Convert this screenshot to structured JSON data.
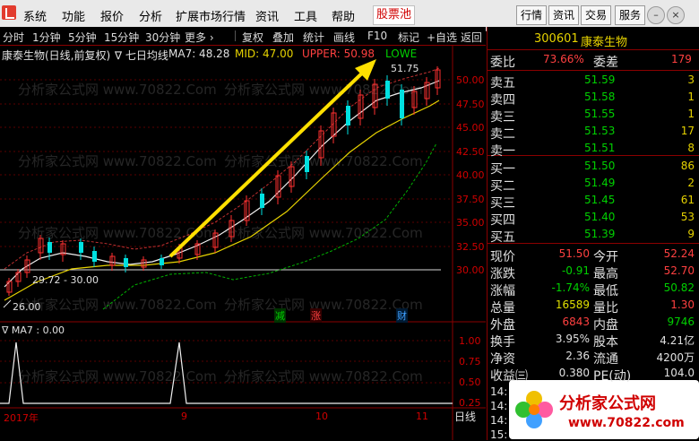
{
  "menu": {
    "items": [
      "系统",
      "功能",
      "报价",
      "分析",
      "扩展市场行情",
      "资讯",
      "工具",
      "帮助"
    ],
    "highlight": "股票池",
    "right_tabs": [
      "行情",
      "资讯",
      "交易",
      "服务"
    ]
  },
  "toolbar": {
    "items": [
      "分时",
      "1分钟",
      "5分钟",
      "15分钟",
      "30分钟",
      "更多 ›"
    ],
    "actions": [
      "复权",
      "叠加",
      "统计",
      "画线",
      "F10",
      "标记",
      "+自选",
      "返回"
    ]
  },
  "chart": {
    "stock_name": "康泰生物(日线,前复权)",
    "ma_label": "∇ 七日均线",
    "ma7": "MA7: 48.28",
    "mid": "MID: 47.00",
    "upper": "UPPER: 50.98",
    "lower": "LOWE",
    "high_mark": "51.75",
    "low_mark": "26.00",
    "range_mark": "29.72 - 30.00",
    "y_ticks": [
      "50.00",
      "47.50",
      "45.00",
      "42.50",
      "40.00",
      "37.50",
      "35.00",
      "32.50",
      "30.00"
    ],
    "tags": [
      "减",
      "涨",
      "财"
    ],
    "ind_label": "∇ MA7 : 0.00",
    "ind_ticks": [
      "1.00",
      "0.75",
      "0.50",
      "0.25"
    ],
    "x_labels": [
      "2017年",
      "9",
      "10",
      "11"
    ],
    "period": "日线",
    "watermark": "分析家公式网 www.70822.Com",
    "site": "www.70822.com",
    "site_name": "分析家公式网"
  },
  "panel": {
    "code": "300601",
    "name": "康泰生物",
    "weibi_label": "委比",
    "weibi": "73.66%",
    "weicha_label": "委差",
    "weicha": "179",
    "sell": [
      {
        "label": "卖五",
        "price": "51.59",
        "vol": "3"
      },
      {
        "label": "卖四",
        "price": "51.58",
        "vol": "1"
      },
      {
        "label": "卖三",
        "price": "51.55",
        "vol": "1"
      },
      {
        "label": "卖二",
        "price": "51.53",
        "vol": "17"
      },
      {
        "label": "卖一",
        "price": "51.51",
        "vol": "8"
      }
    ],
    "buy": [
      {
        "label": "买一",
        "price": "51.50",
        "vol": "86"
      },
      {
        "label": "买二",
        "price": "51.49",
        "vol": "2"
      },
      {
        "label": "买三",
        "price": "51.45",
        "vol": "61"
      },
      {
        "label": "买四",
        "price": "51.40",
        "vol": "53"
      },
      {
        "label": "买五",
        "price": "51.39",
        "vol": "9"
      }
    ],
    "stats": [
      {
        "l1": "现价",
        "v1": "51.50",
        "c1": "#ff4040",
        "l2": "今开",
        "v2": "52.24",
        "c2": "#ff4040"
      },
      {
        "l1": "涨跌",
        "v1": "-0.91",
        "c1": "#00d000",
        "l2": "最高",
        "v2": "52.70",
        "c2": "#ff4040"
      },
      {
        "l1": "涨幅",
        "v1": "-1.74%",
        "c1": "#00d000",
        "l2": "最低",
        "v2": "50.82",
        "c2": "#00d000"
      },
      {
        "l1": "总量",
        "v1": "16589",
        "c1": "#e0e000",
        "l2": "量比",
        "v2": "1.30",
        "c2": "#ff4040"
      },
      {
        "l1": "外盘",
        "v1": "6843",
        "c1": "#ff4040",
        "l2": "内盘",
        "v2": "9746",
        "c2": "#00d000"
      },
      {
        "l1": "换手",
        "v1": "3.95%",
        "c1": "#e0e0e0",
        "l2": "股本",
        "v2": "4.21亿",
        "c2": "#e0e0e0"
      },
      {
        "l1": "净资",
        "v1": "2.36",
        "c1": "#e0e0e0",
        "l2": "流通",
        "v2": "4200万",
        "c2": "#e0e0e0"
      },
      {
        "l1": "收益㈢",
        "v1": "0.380",
        "c1": "#e0e0e0",
        "l2": "PE(动)",
        "v2": "104.0",
        "c2": "#e0e0e0"
      }
    ],
    "ticks": [
      "14:",
      "14:",
      "14:",
      "15:"
    ]
  }
}
